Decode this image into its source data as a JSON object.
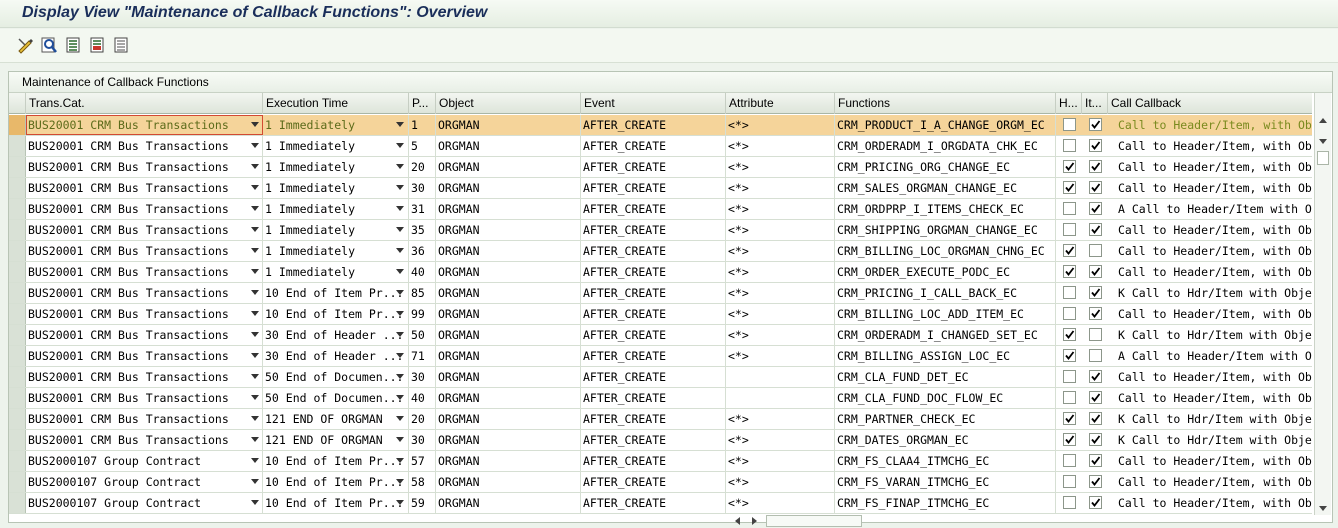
{
  "window": {
    "title": "Display View \"Maintenance of Callback Functions\": Overview"
  },
  "toolbar": {
    "icons": [
      "display-change-icon",
      "find-icon",
      "select-all-icon",
      "select-block-icon",
      "deselect-all-icon"
    ]
  },
  "panel": {
    "title": "Maintenance of Callback Functions"
  },
  "table": {
    "columns": {
      "trans_cat": "Trans.Cat.",
      "exec_time": "Execution Time",
      "pos": "P...",
      "object": "Object",
      "event": "Event",
      "attribute": "Attribute",
      "functions": "Functions",
      "h": "H...",
      "it": "It...",
      "call_callback": "Call Callback"
    },
    "selected_row": 0,
    "rows": [
      {
        "trans_cat": "BUS20001 CRM Bus Transactions",
        "exec_time": "1 Immediately",
        "pos": "1",
        "object": "ORGMAN",
        "event": "AFTER_CREATE",
        "attribute": "<*>",
        "function": "CRM_PRODUCT_I_A_CHANGE_ORGM_EC",
        "h": false,
        "it": true,
        "callback": "Call to Header/Item, with Ob"
      },
      {
        "trans_cat": "BUS20001 CRM Bus Transactions",
        "exec_time": "1 Immediately",
        "pos": "5",
        "object": "ORGMAN",
        "event": "AFTER_CREATE",
        "attribute": "<*>",
        "function": "CRM_ORDERADM_I_ORGDATA_CHK_EC",
        "h": false,
        "it": true,
        "callback": "Call to Header/Item, with Ob"
      },
      {
        "trans_cat": "BUS20001 CRM Bus Transactions",
        "exec_time": "1 Immediately",
        "pos": "20",
        "object": "ORGMAN",
        "event": "AFTER_CREATE",
        "attribute": "<*>",
        "function": "CRM_PRICING_ORG_CHANGE_EC",
        "h": true,
        "it": true,
        "callback": "Call to Header/Item, with Ob"
      },
      {
        "trans_cat": "BUS20001 CRM Bus Transactions",
        "exec_time": "1 Immediately",
        "pos": "30",
        "object": "ORGMAN",
        "event": "AFTER_CREATE",
        "attribute": "<*>",
        "function": "CRM_SALES_ORGMAN_CHANGE_EC",
        "h": true,
        "it": true,
        "callback": "Call to Header/Item, with Ob"
      },
      {
        "trans_cat": "BUS20001 CRM Bus Transactions",
        "exec_time": "1 Immediately",
        "pos": "31",
        "object": "ORGMAN",
        "event": "AFTER_CREATE",
        "attribute": "<*>",
        "function": "CRM_ORDPRP_I_ITEMS_CHECK_EC",
        "h": false,
        "it": true,
        "callback": "A Call to Header/Item with Ob"
      },
      {
        "trans_cat": "BUS20001 CRM Bus Transactions",
        "exec_time": "1 Immediately",
        "pos": "35",
        "object": "ORGMAN",
        "event": "AFTER_CREATE",
        "attribute": "<*>",
        "function": "CRM_SHIPPING_ORGMAN_CHANGE_EC",
        "h": false,
        "it": true,
        "callback": "Call to Header/Item, with Ob"
      },
      {
        "trans_cat": "BUS20001 CRM Bus Transactions",
        "exec_time": "1 Immediately",
        "pos": "36",
        "object": "ORGMAN",
        "event": "AFTER_CREATE",
        "attribute": "<*>",
        "function": "CRM_BILLING_LOC_ORGMAN_CHNG_EC",
        "h": true,
        "it": false,
        "callback": "Call to Header/Item, with Ob"
      },
      {
        "trans_cat": "BUS20001 CRM Bus Transactions",
        "exec_time": "1 Immediately",
        "pos": "40",
        "object": "ORGMAN",
        "event": "AFTER_CREATE",
        "attribute": "<*>",
        "function": "CRM_ORDER_EXECUTE_PODC_EC",
        "h": true,
        "it": true,
        "callback": "Call to Header/Item, with Ob"
      },
      {
        "trans_cat": "BUS20001 CRM Bus Transactions",
        "exec_time": "10 End of Item Pr...",
        "pos": "85",
        "object": "ORGMAN",
        "event": "AFTER_CREATE",
        "attribute": "<*>",
        "function": "CRM_PRICING_I_CALL_BACK_EC",
        "h": false,
        "it": true,
        "callback": "K Call to Hdr/Item with Objec"
      },
      {
        "trans_cat": "BUS20001 CRM Bus Transactions",
        "exec_time": "10 End of Item Pr...",
        "pos": "99",
        "object": "ORGMAN",
        "event": "AFTER_CREATE",
        "attribute": "<*>",
        "function": "CRM_BILLING_LOC_ADD_ITEM_EC",
        "h": false,
        "it": true,
        "callback": "Call to Header/Item, with Ob"
      },
      {
        "trans_cat": "BUS20001 CRM Bus Transactions",
        "exec_time": "30 End of Header ...",
        "pos": "50",
        "object": "ORGMAN",
        "event": "AFTER_CREATE",
        "attribute": "<*>",
        "function": "CRM_ORDERADM_I_CHANGED_SET_EC",
        "h": true,
        "it": false,
        "callback": "K Call to Hdr/Item with Objec"
      },
      {
        "trans_cat": "BUS20001 CRM Bus Transactions",
        "exec_time": "30 End of Header ...",
        "pos": "71",
        "object": "ORGMAN",
        "event": "AFTER_CREATE",
        "attribute": "<*>",
        "function": "CRM_BILLING_ASSIGN_LOC_EC",
        "h": true,
        "it": false,
        "callback": "A Call to Header/Item with Ob"
      },
      {
        "trans_cat": "BUS20001 CRM Bus Transactions",
        "exec_time": "50 End of Documen...",
        "pos": "30",
        "object": "ORGMAN",
        "event": "AFTER_CREATE",
        "attribute": "",
        "function": "CRM_CLA_FUND_DET_EC",
        "h": false,
        "it": true,
        "callback": "Call to Header/Item, with Ob"
      },
      {
        "trans_cat": "BUS20001 CRM Bus Transactions",
        "exec_time": "50 End of Documen...",
        "pos": "40",
        "object": "ORGMAN",
        "event": "AFTER_CREATE",
        "attribute": "",
        "function": "CRM_CLA_FUND_DOC_FLOW_EC",
        "h": false,
        "it": true,
        "callback": "Call to Header/Item, with Ob"
      },
      {
        "trans_cat": "BUS20001 CRM Bus Transactions",
        "exec_time": "121 END OF ORGMAN",
        "pos": "20",
        "object": "ORGMAN",
        "event": "AFTER_CREATE",
        "attribute": "<*>",
        "function": "CRM_PARTNER_CHECK_EC",
        "h": true,
        "it": true,
        "callback": "K Call to Hdr/Item with Objec"
      },
      {
        "trans_cat": "BUS20001 CRM Bus Transactions",
        "exec_time": "121 END OF ORGMAN",
        "pos": "30",
        "object": "ORGMAN",
        "event": "AFTER_CREATE",
        "attribute": "<*>",
        "function": "CRM_DATES_ORGMAN_EC",
        "h": true,
        "it": true,
        "callback": "K Call to Hdr/Item with Objec"
      },
      {
        "trans_cat": "BUS2000107 Group Contract",
        "exec_time": "10 End of Item Pr...",
        "pos": "57",
        "object": "ORGMAN",
        "event": "AFTER_CREATE",
        "attribute": "<*>",
        "function": "CRM_FS_CLAA4_ITMCHG_EC",
        "h": false,
        "it": true,
        "callback": "Call to Header/Item, with Ob"
      },
      {
        "trans_cat": "BUS2000107 Group Contract",
        "exec_time": "10 End of Item Pr...",
        "pos": "58",
        "object": "ORGMAN",
        "event": "AFTER_CREATE",
        "attribute": "<*>",
        "function": "CRM_FS_VARAN_ITMCHG_EC",
        "h": false,
        "it": true,
        "callback": "Call to Header/Item, with Ob"
      },
      {
        "trans_cat": "BUS2000107 Group Contract",
        "exec_time": "10 End of Item Pr...",
        "pos": "59",
        "object": "ORGMAN",
        "event": "AFTER_CREATE",
        "attribute": "<*>",
        "function": "CRM_FS_FINAP_ITMCHG_EC",
        "h": false,
        "it": true,
        "callback": "Call to Header/Item, with Ob"
      }
    ]
  },
  "icons": {
    "settings": "table-settings-icon",
    "scroll_up": "scroll-up-icon",
    "scroll_down": "scroll-down-icon",
    "scroll_left": "scroll-left-icon",
    "scroll_right": "scroll-right-icon",
    "dropdown": "dropdown-arrow-icon",
    "checkbox_checked": "checkmark-icon"
  },
  "colors": {
    "selected_row": "#f5d49a",
    "title": "#1a2e5a",
    "background": "#edf3ec"
  }
}
